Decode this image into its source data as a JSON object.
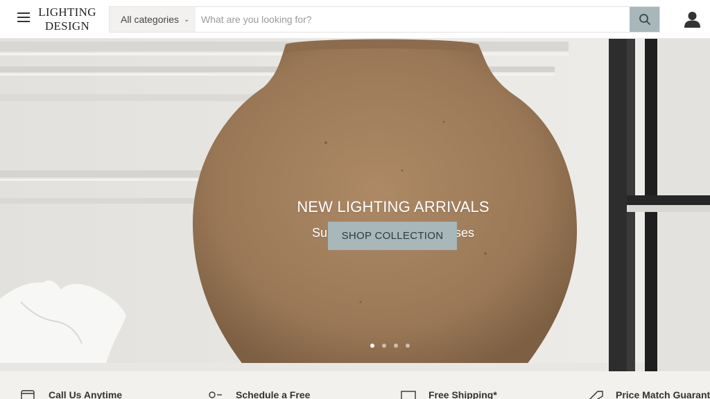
{
  "header": {
    "logo_line1": "LIGHTING",
    "logo_line2": "DESIGN",
    "search": {
      "category": "All categories",
      "placeholder": "What are you looking for?"
    }
  },
  "hero": {
    "title": "NEW LIGHTING ARRIVALS",
    "subtitle": "Summer 2025 New Releases",
    "cta": "SHOP COLLECTION",
    "slide_count": 4,
    "active_slide": 1
  },
  "benefits": [
    {
      "label": "Call Us Anytime",
      "icon": "laptop-icon"
    },
    {
      "label": "Schedule a Free",
      "icon": "person-icon"
    },
    {
      "label": "Free Shipping*",
      "icon": "box-icon"
    },
    {
      "label": "Price Match Guarantee",
      "icon": "tag-icon"
    }
  ],
  "colors": {
    "accent": "#a7b7ba",
    "strip_bg": "#f3f1ee"
  }
}
